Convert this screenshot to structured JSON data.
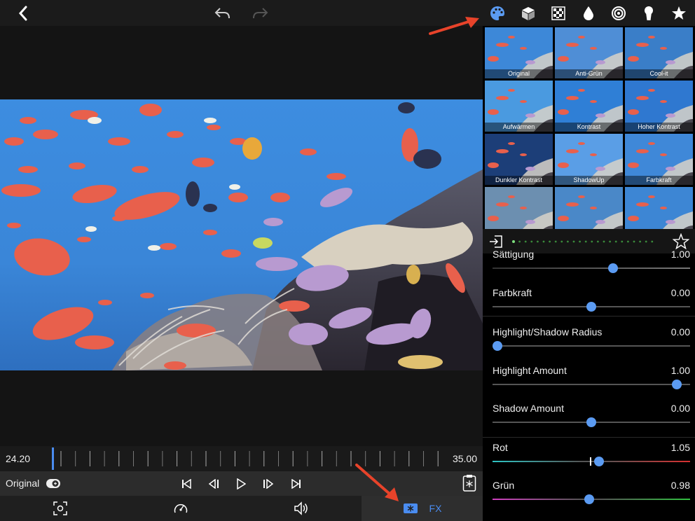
{
  "top_tabs": [
    "palette-icon",
    "cube-icon",
    "grid-pattern-icon",
    "drop-icon",
    "spiral-icon",
    "keyhole-icon",
    "star-icon"
  ],
  "presets": [
    {
      "label": "Original"
    },
    {
      "label": "Anti-Grün"
    },
    {
      "label": "Cool-it"
    },
    {
      "label": "Aufwärmen"
    },
    {
      "label": "Kontrast"
    },
    {
      "label": "Hoher Kontrast"
    },
    {
      "label": "Dunkler Kontrast"
    },
    {
      "label": "ShadowUp"
    },
    {
      "label": "Farbkraft"
    },
    {
      "label": ""
    },
    {
      "label": ""
    },
    {
      "label": ""
    }
  ],
  "sliders": [
    {
      "label": "Sättigung",
      "value": "1.00",
      "fraction": 0.615
    },
    {
      "label": "Farbkraft",
      "value": "0.00",
      "fraction": 0.5
    },
    {
      "label": "Highlight/Shadow Radius",
      "value": "0.00",
      "fraction": 0.0
    },
    {
      "label": "Highlight Amount",
      "value": "1.00",
      "fraction": 0.955
    },
    {
      "label": "Shadow Amount",
      "value": "0.00",
      "fraction": 0.5
    },
    {
      "label": "Rot",
      "value": "1.05",
      "fraction": 0.54
    },
    {
      "label": "Grün",
      "value": "0.98",
      "fraction": 0.49
    }
  ],
  "timeline": {
    "start": "24.20",
    "end": "35.00",
    "progress": 0.0
  },
  "controls": {
    "original_label": "Original"
  },
  "bottombar": {
    "fx_label": "FX"
  },
  "colors": {
    "accent": "#4a8cf0",
    "arrow": "#e8432a"
  }
}
